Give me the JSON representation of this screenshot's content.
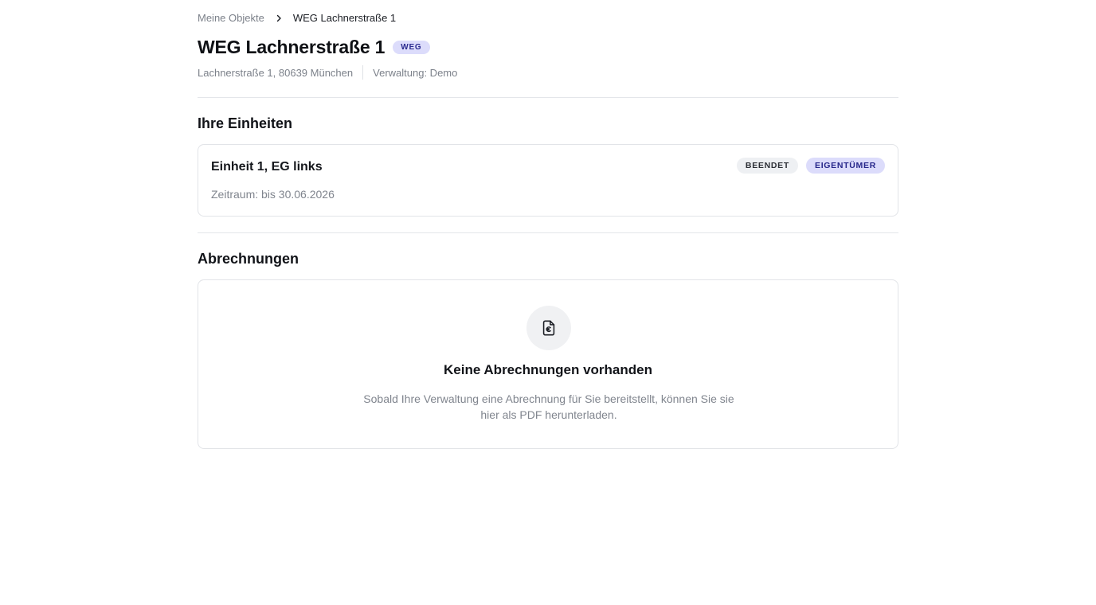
{
  "breadcrumb": {
    "parent": "Meine Objekte",
    "current": "WEG Lachnerstraße 1"
  },
  "property": {
    "title": "WEG Lachnerstraße 1",
    "type_badge": "WEG",
    "address": "Lachnerstraße 1, 80639 München",
    "management": "Verwaltung: Demo"
  },
  "units_section": {
    "title": "Ihre Einheiten",
    "units": [
      {
        "name": "Einheit 1, EG links",
        "period": "Zeitraum: bis 30.06.2026",
        "badges": [
          "BEENDET",
          "EIGENTÜMER"
        ]
      }
    ]
  },
  "billing_section": {
    "title": "Abrechnungen",
    "empty_title": "Keine Abrechnungen vorhanden",
    "empty_text": "Sobald Ihre Verwaltung eine Abrechnung für Sie bereitstellt, können Sie sie hier als PDF herunterladen.",
    "empty_icon": "file-euro-icon"
  },
  "colors": {
    "accent_badge_bg": "#dcdcfb",
    "accent_badge_text": "#26268a",
    "muted_text": "#7c818a",
    "border": "#e2e4e8"
  }
}
